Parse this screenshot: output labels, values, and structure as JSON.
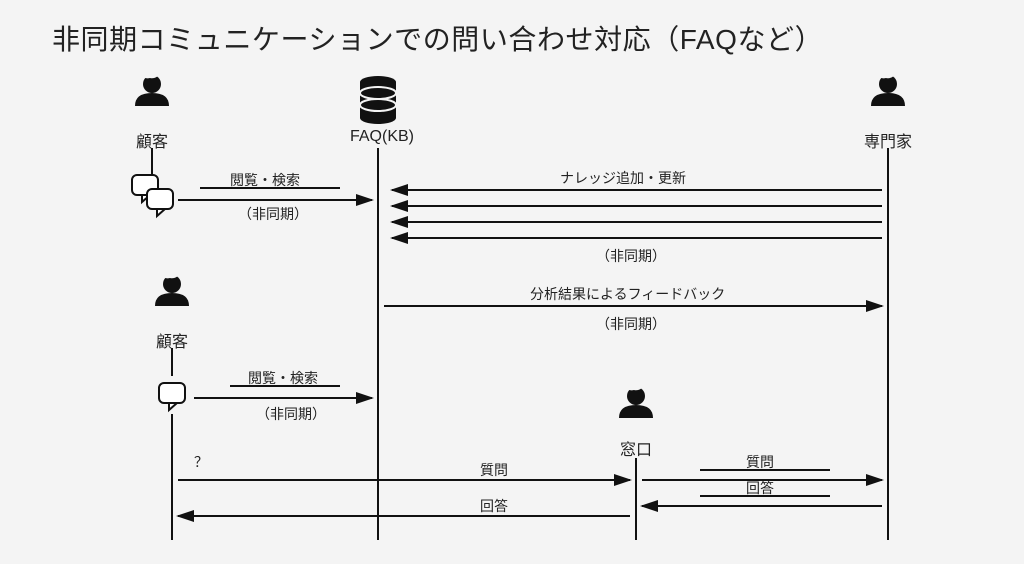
{
  "title": "非同期コミュニケーションでの問い合わせ対応（FAQなど）",
  "actors": {
    "customer1": "顧客",
    "faq": "FAQ(KB)",
    "expert": "専門家",
    "customer2": "顧客",
    "frontdesk": "窓口"
  },
  "edges": {
    "browse1": "閲覧・検索",
    "browse1_note": "（非同期）",
    "knowledge": "ナレッジ追加・更新",
    "knowledge_note": "（非同期）",
    "feedback": "分析結果によるフィードバック",
    "feedback_note": "（非同期）",
    "browse2": "閲覧・検索",
    "browse2_note": "（非同期）",
    "qmark": "？",
    "question1": "質問",
    "answer1": "回答",
    "question2": "質問",
    "answer2": "回答"
  }
}
